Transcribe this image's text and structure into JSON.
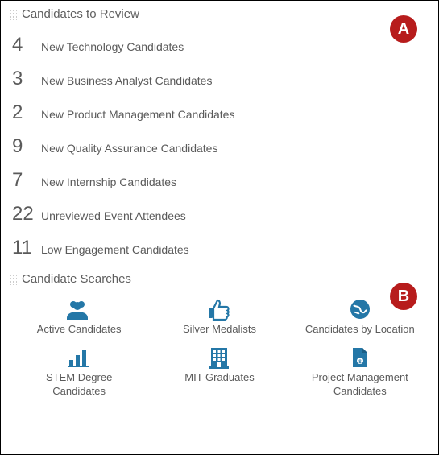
{
  "sections": {
    "review": {
      "title": "Candidates to Review",
      "items": [
        {
          "count": "4",
          "label": "New Technology Candidates"
        },
        {
          "count": "3",
          "label": "New Business Analyst Candidates"
        },
        {
          "count": "2",
          "label": "New Product Management Candidates"
        },
        {
          "count": "9",
          "label": "New Quality Assurance Candidates"
        },
        {
          "count": "7",
          "label": "New Internship Candidates"
        },
        {
          "count": "22",
          "label": "Unreviewed Event Attendees"
        },
        {
          "count": "11",
          "label": "Low Engagement Candidates"
        }
      ]
    },
    "searches": {
      "title": "Candidate Searches",
      "tiles": [
        {
          "icon": "people-icon",
          "label": "Active Candidates"
        },
        {
          "icon": "thumbsup-icon",
          "label": "Silver Medalists"
        },
        {
          "icon": "globe-icon",
          "label": "Candidates by Location"
        },
        {
          "icon": "barchart-icon",
          "label": "STEM Degree Candidates"
        },
        {
          "icon": "building-icon",
          "label": "MIT Graduates"
        },
        {
          "icon": "document-icon",
          "label": "Project Management Candidates"
        }
      ]
    }
  },
  "callouts": {
    "a": "A",
    "b": "B"
  },
  "colors": {
    "accent": "#2477a7",
    "badge": "#b71c1c"
  }
}
